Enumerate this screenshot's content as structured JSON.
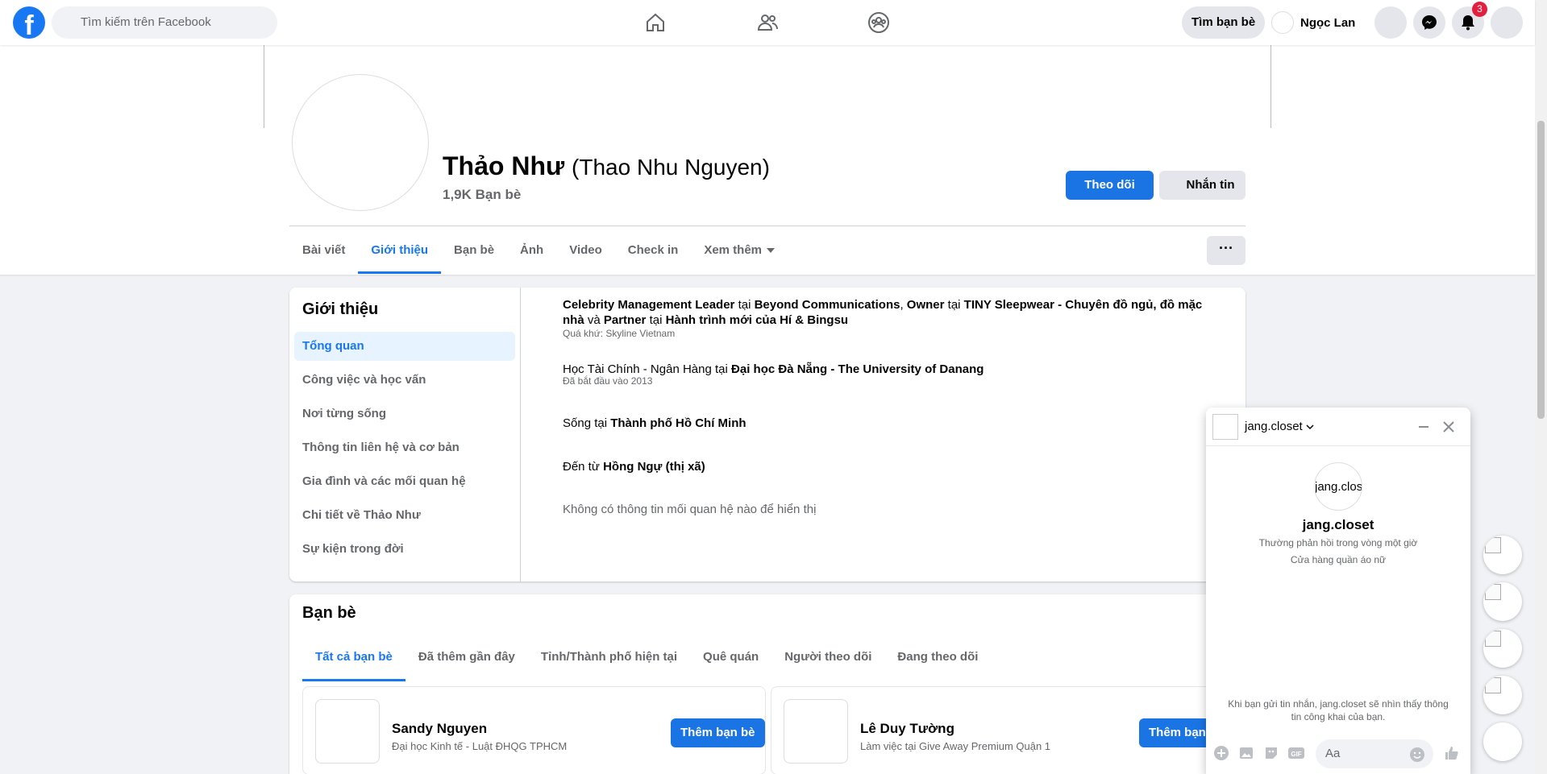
{
  "topbar": {
    "logo": "f",
    "search_placeholder": "Tìm kiếm trên Facebook",
    "find_friends": "Tìm bạn bè",
    "user_name": "Ngọc Lan",
    "notification_count": "3"
  },
  "profile": {
    "name": "Thảo Như",
    "alt_name": "(Thao Nhu Nguyen)",
    "friend_count": "1,9K Bạn bè",
    "follow_label": "Theo dõi",
    "message_label": "Nhắn tin"
  },
  "tabs": [
    {
      "label": "Bài viết"
    },
    {
      "label": "Giới thiệu"
    },
    {
      "label": "Bạn bè"
    },
    {
      "label": "Ảnh"
    },
    {
      "label": "Video"
    },
    {
      "label": "Check in"
    },
    {
      "label": "Xem thêm"
    }
  ],
  "more_button": "···",
  "about": {
    "title": "Giới thiệu",
    "side_items": [
      {
        "label": "Tổng quan"
      },
      {
        "label": "Công việc và học vấn"
      },
      {
        "label": "Nơi từng sống"
      },
      {
        "label": "Thông tin liên hệ và cơ bản"
      },
      {
        "label": "Gia đình và các mối quan hệ"
      },
      {
        "label": "Chi tiết về Thảo Như"
      },
      {
        "label": "Sự kiện trong đời"
      }
    ],
    "work": {
      "role1": "Celebrity Management Leader",
      "at": "tại",
      "company1": "Beyond Communications",
      "role2": "Owner",
      "company2": "TINY Sleepwear - Chuyên đồ ngủ, đồ mặc nhà",
      "and": "và",
      "role3": "Partner",
      "company3": "Hành trình mới của Hí & Bingsu",
      "past": "Quá khứ: Skyline Vietnam"
    },
    "education": {
      "prefix": "Học Tài Chính - Ngân Hàng tại",
      "school": "Đại học Đà Nẵng - The University of Danang",
      "since": "Đã bắt đầu vào 2013"
    },
    "lives": {
      "prefix": "Sống tại",
      "place": "Thành phố Hồ Chí Minh"
    },
    "from": {
      "prefix": "Đến từ",
      "place": "Hồng Ngự (thị xã)"
    },
    "relationship": "Không có thông tin mối quan hệ nào để hiển thị"
  },
  "friends": {
    "title": "Bạn bè",
    "tabs": [
      {
        "label": "Tất cả bạn bè"
      },
      {
        "label": "Đã thêm gần đây"
      },
      {
        "label": "Tỉnh/Thành phố hiện tại"
      },
      {
        "label": "Quê quán"
      },
      {
        "label": "Người theo dõi"
      },
      {
        "label": "Đang theo dõi"
      }
    ],
    "items": [
      {
        "name": "Sandy Nguyen",
        "sub": "Đại học Kinh tế - Luật ĐHQG TPHCM",
        "button": "Thêm bạn bè"
      },
      {
        "name": "Lê Duy Tường",
        "sub": "Làm việc tại Give Away Premium Quận 1",
        "button": "Thêm bạn bè"
      }
    ]
  },
  "chat": {
    "name": "jang.closet",
    "avatar_alt": "jang.clos",
    "profile_name": "jang.closet",
    "response": "Thường phản hồi trong vòng một giờ",
    "category": "Cửa hàng quần áo nữ",
    "notice": "Khi bạn gửi tin nhắn, jang.closet sẽ nhìn thấy thông tin công khai của bạn.",
    "input_placeholder": "Aa",
    "gif_label": "GIF"
  },
  "colors": {
    "brand": "#1877f2",
    "button_blue": "#1b74e4",
    "badge_red": "#e41e3f"
  }
}
